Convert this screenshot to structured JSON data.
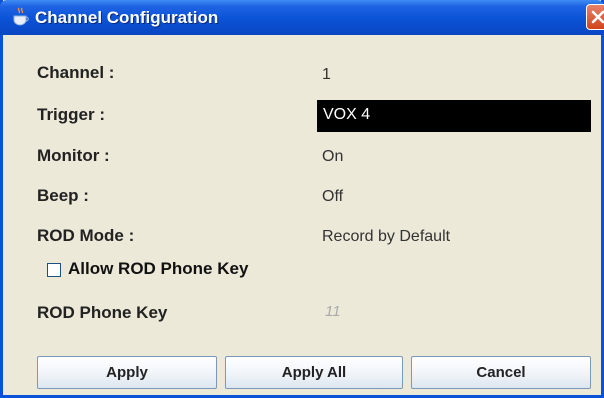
{
  "window": {
    "title": "Channel Configuration"
  },
  "fields": {
    "channel": {
      "label": "Channel :",
      "value": "1"
    },
    "trigger": {
      "label": "Trigger :",
      "value": "VOX 4"
    },
    "monitor": {
      "label": "Monitor :",
      "value": "On"
    },
    "beep": {
      "label": "Beep :",
      "value": "Off"
    },
    "rod_mode": {
      "label": "ROD Mode :",
      "value": "Record by Default"
    },
    "allow_rod_phone_key": {
      "label": "Allow ROD Phone Key",
      "checked": false
    },
    "rod_phone_key": {
      "label": "ROD Phone Key",
      "value": "11"
    }
  },
  "buttons": {
    "apply": "Apply",
    "apply_all": "Apply All",
    "cancel": "Cancel"
  },
  "icons": {
    "title": "java-cup-icon",
    "close": "close-icon"
  },
  "colors": {
    "titlebar": "#0a52d6",
    "close": "#d2431c",
    "background": "#ece9d8",
    "trigger_bg": "#000000"
  }
}
